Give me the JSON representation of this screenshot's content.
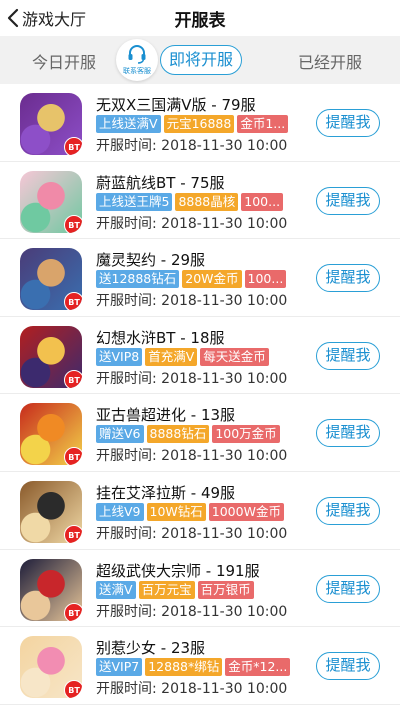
{
  "header": {
    "back_label": "游戏大厅",
    "title": "开服表"
  },
  "tabs": {
    "today": "今日开服",
    "customer_service": "联系客服",
    "upcoming": "即将开服",
    "opened": "已经开服"
  },
  "colors": {
    "accent": "#2a9fd6",
    "tag_blue": "#5aa9e6",
    "tag_orange": "#f4a72a",
    "tag_red": "#e96a6a",
    "bt_badge": "#e52222"
  },
  "games": [
    {
      "name": "无双X三国满V版 - 79服",
      "tags": [
        "上线送满V",
        "元宝16888",
        "金币1..."
      ],
      "time": "开服时间: 2018-11-30 10:00",
      "bt": "BT",
      "remind": "提醒我",
      "art": [
        "#6b2c8f",
        "#e7c36a",
        "#8d4fc8"
      ]
    },
    {
      "name": "蔚蓝航线BT - 75服",
      "tags": [
        "上线送王牌5",
        "8888晶核",
        "100..."
      ],
      "time": "开服时间: 2018-11-30 10:00",
      "bt": "BT",
      "remind": "提醒我",
      "art": [
        "#f6c7d6",
        "#f08aa8",
        "#6fc9a1"
      ]
    },
    {
      "name": "魔灵契约 - 29服",
      "tags": [
        "送12888钻石",
        "20W金币",
        "100..."
      ],
      "time": "开服时间: 2018-11-30 10:00",
      "bt": "BT",
      "remind": "提醒我",
      "art": [
        "#4a3c78",
        "#d9a46b",
        "#3a6fb0"
      ]
    },
    {
      "name": "幻想水浒BT - 18服",
      "tags": [
        "送VIP8",
        "首充满V",
        "每天送金币"
      ],
      "time": "开服时间: 2018-11-30 10:00",
      "bt": "BT",
      "remind": "提醒我",
      "art": [
        "#b21f1f",
        "#f2c14e",
        "#3c2a6e"
      ]
    },
    {
      "name": "亚古兽超进化 - 13服",
      "tags": [
        "赠送V6",
        "8888钻石",
        "100万金币"
      ],
      "time": "开服时间: 2018-11-30 10:00",
      "bt": "BT",
      "remind": "提醒我",
      "art": [
        "#c72b1c",
        "#f08a24",
        "#f3d34a"
      ]
    },
    {
      "name": "挂在艾泽拉斯 - 49服",
      "tags": [
        "上线V9",
        "10W钻石",
        "1000W金币"
      ],
      "time": "开服时间: 2018-11-30 10:00",
      "bt": "BT",
      "remind": "提醒我",
      "art": [
        "#8a5a2b",
        "#2b2b2b",
        "#f0d9a6"
      ]
    },
    {
      "name": "超级武侠大宗师 - 191服",
      "tags": [
        "送满V",
        "百万元宝",
        "百万银币"
      ],
      "time": "开服时间: 2018-11-30 10:00",
      "bt": "BT",
      "remind": "提醒我",
      "art": [
        "#1e1e3a",
        "#c8262b",
        "#e9c79a"
      ]
    },
    {
      "name": "别惹少女 - 23服",
      "tags": [
        "送VIP7",
        "12888*绑钻",
        "金币*12..."
      ],
      "time": "开服时间: 2018-11-30 10:00",
      "bt": "BT",
      "remind": "提醒我",
      "art": [
        "#f3d4a0",
        "#f28db2",
        "#f7e6c8"
      ]
    }
  ]
}
